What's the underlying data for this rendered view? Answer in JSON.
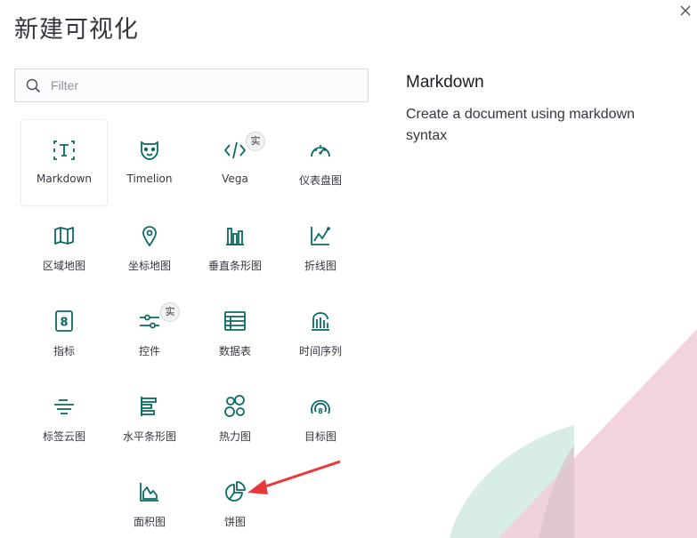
{
  "dialog": {
    "title": "新建可视化",
    "search": {
      "placeholder": "Filter",
      "value": ""
    },
    "types": [
      {
        "label": "Markdown",
        "icon": "markdown-icon",
        "selected": true
      },
      {
        "label": "Timelion",
        "icon": "timelion-icon"
      },
      {
        "label": "Vega",
        "icon": "code-icon",
        "badge": "实"
      },
      {
        "label": "仪表盘图",
        "icon": "gauge-icon"
      },
      {
        "label": "区域地图",
        "icon": "region-map-icon"
      },
      {
        "label": "坐标地图",
        "icon": "location-pin-icon"
      },
      {
        "label": "垂直条形图",
        "icon": "vertical-bar-icon"
      },
      {
        "label": "折线图",
        "icon": "line-chart-icon"
      },
      {
        "label": "指标",
        "icon": "metric-icon"
      },
      {
        "label": "控件",
        "icon": "controls-icon",
        "badge": "实"
      },
      {
        "label": "数据表",
        "icon": "data-table-icon"
      },
      {
        "label": "时间序列",
        "icon": "timeseries-icon"
      },
      {
        "label": "标签云图",
        "icon": "tag-cloud-icon"
      },
      {
        "label": "水平条形图",
        "icon": "horizontal-bar-icon"
      },
      {
        "label": "热力图",
        "icon": "heatmap-icon"
      },
      {
        "label": "目标图",
        "icon": "goal-icon"
      },
      {
        "label": "面积图",
        "icon": "area-chart-icon"
      },
      {
        "label": "饼图",
        "icon": "pie-chart-icon"
      }
    ],
    "detail": {
      "title": "Markdown",
      "description": "Create a document using markdown syntax"
    }
  },
  "colors": {
    "icon": "#0b6b63",
    "text": "#343741",
    "arrow": "#e8383b"
  }
}
